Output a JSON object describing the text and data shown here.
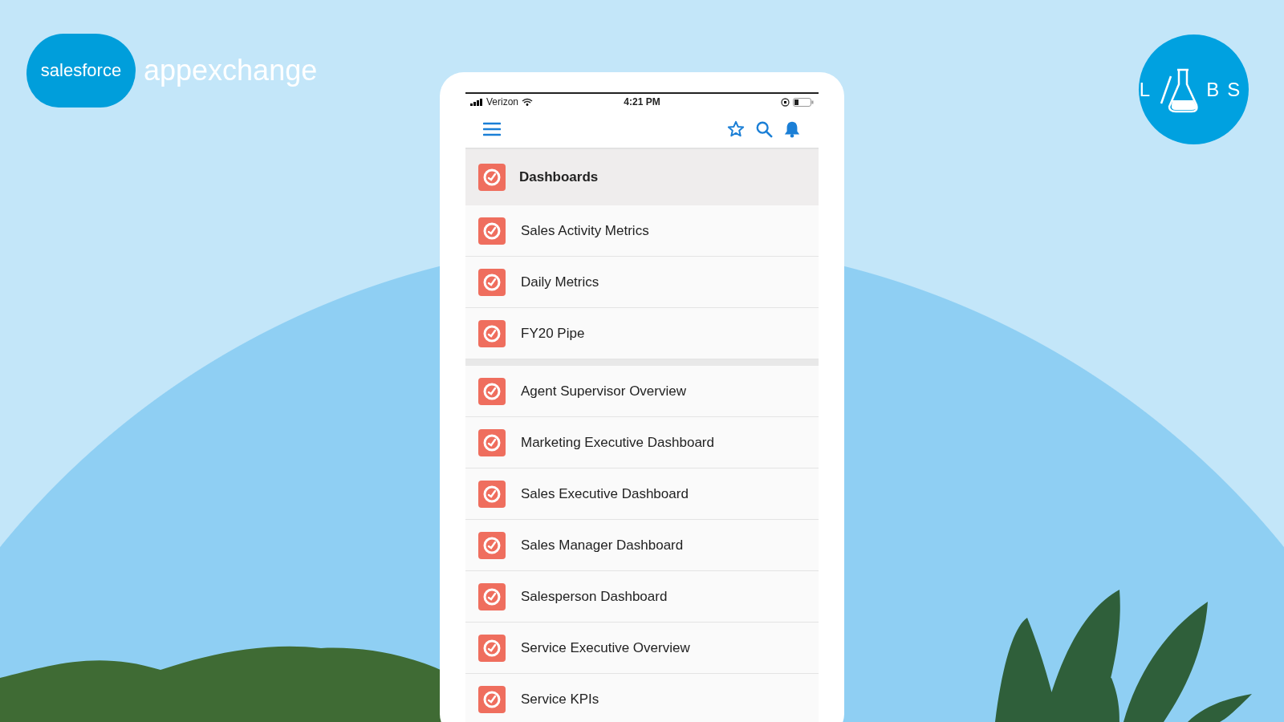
{
  "brand": {
    "cloud_text": "salesforce",
    "product": "appexchange"
  },
  "labs_logo": {
    "left_letter": "L",
    "right_letters": "BS"
  },
  "status_bar": {
    "carrier": "Verizon",
    "time": "4:21 PM"
  },
  "menu": {
    "title": "Dashboards",
    "groups": [
      {
        "items": [
          {
            "label": "Sales Activity Metrics"
          },
          {
            "label": "Daily Metrics"
          },
          {
            "label": "FY20 Pipe"
          }
        ]
      },
      {
        "items": [
          {
            "label": "Agent Supervisor Overview"
          },
          {
            "label": "Marketing Executive Dashboard"
          },
          {
            "label": "Sales Executive Dashboard"
          },
          {
            "label": "Sales Manager Dashboard"
          },
          {
            "label": "Salesperson Dashboard"
          },
          {
            "label": "Service Executive Overview"
          },
          {
            "label": "Service KPIs"
          }
        ]
      }
    ]
  }
}
